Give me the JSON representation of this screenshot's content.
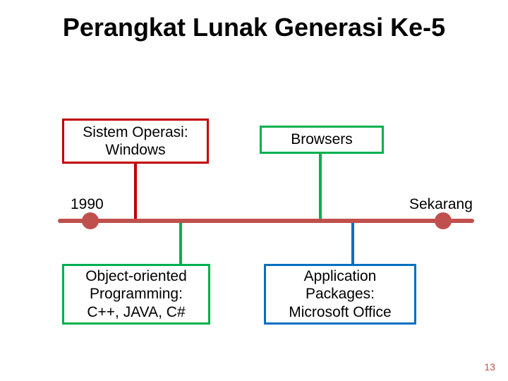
{
  "title": "Perangkat Lunak Generasi Ke-5",
  "timeline": {
    "start_label": "1990",
    "end_label": "Sekarang",
    "color": "#c0504d"
  },
  "boxes": {
    "os": {
      "text": "Sistem Operasi:\nWindows",
      "border": "#c00000"
    },
    "br": {
      "text": "Browsers",
      "border": "#00b050"
    },
    "oop": {
      "text": "Object-oriented\nProgramming:\nC++, JAVA, C#",
      "border": "#00b050"
    },
    "app": {
      "text": "Application\nPackages:\nMicrosoft Office",
      "border": "#0070c0"
    }
  },
  "page_number": "13"
}
